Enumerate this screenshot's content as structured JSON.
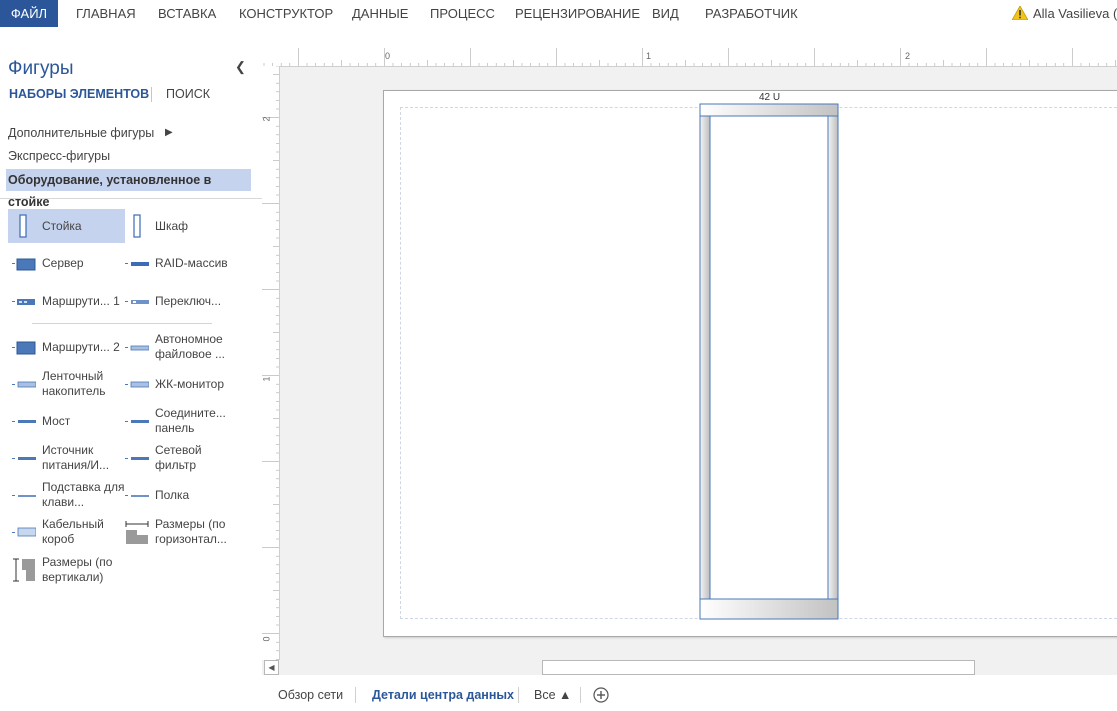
{
  "ribbon": {
    "file_tab": "ФАЙЛ",
    "tabs": [
      "ГЛАВНАЯ",
      "ВСТАВКА",
      "КОНСТРУКТОР",
      "ДАННЫЕ",
      "ПРОЦЕСС",
      "РЕЦЕНЗИРОВАНИЕ",
      "ВИД",
      "РАЗРАБОТЧИК"
    ],
    "user": "Alla Vasilieva (M",
    "accent_color": "#2b579a"
  },
  "shapes_pane": {
    "title": "Фигуры",
    "collapse_icon": "chevron-left-icon",
    "tab_sets": "НАБОРЫ ЭЛЕМЕНТОВ",
    "tab_search": "ПОИСК",
    "stencils": [
      {
        "label": "Дополнительные фигуры",
        "has_submenu": true
      },
      {
        "label": "Экспресс-фигуры"
      },
      {
        "label": "Оборудование, установленное в стойке",
        "active": true
      }
    ],
    "shapes": [
      {
        "label": "Стойка",
        "icon": "rack-icon",
        "selected": true
      },
      {
        "label": "Шкаф",
        "icon": "cabinet-icon"
      },
      {
        "label": "Сервер",
        "icon": "server-icon"
      },
      {
        "label": "RAID-массив",
        "icon": "raid-array-icon"
      },
      {
        "label": "Маршрути... 1",
        "icon": "router-1-icon"
      },
      {
        "label": "Переключ...",
        "icon": "switch-icon"
      },
      {
        "label": "Маршрути... 2",
        "icon": "router-2-icon"
      },
      {
        "label": "Автономное файловое ...",
        "icon": "nas-icon"
      },
      {
        "label": "Ленточный накопитель",
        "icon": "tape-drive-icon"
      },
      {
        "label": "ЖК-монитор",
        "icon": "lcd-monitor-icon"
      },
      {
        "label": "Мост",
        "icon": "bridge-icon"
      },
      {
        "label": "Соедините... панель",
        "icon": "patch-panel-icon"
      },
      {
        "label": "Источник питания/И...",
        "icon": "power-supply-icon"
      },
      {
        "label": "Сетевой фильтр",
        "icon": "power-strip-icon"
      },
      {
        "label": "Подставка для клави...",
        "icon": "keyboard-tray-icon"
      },
      {
        "label": "Полка",
        "icon": "shelf-icon"
      },
      {
        "label": "Кабельный короб",
        "icon": "cable-tray-icon"
      },
      {
        "label": "Размеры (по горизонтал...",
        "icon": "dimension-horizontal-icon"
      },
      {
        "label": "Размеры (по вертикали)",
        "icon": "dimension-vertical-icon"
      }
    ]
  },
  "rulers": {
    "horizontal": [
      "0",
      "1",
      "2"
    ],
    "vertical": [
      "2",
      "1",
      "0"
    ]
  },
  "canvas": {
    "rack_label": "42 U"
  },
  "sheets": {
    "tabs": [
      "Обзор сети",
      "Детали центра данных"
    ],
    "active_index": 1,
    "all_label": "Все ▲",
    "add_icon": "add-sheet-icon"
  }
}
